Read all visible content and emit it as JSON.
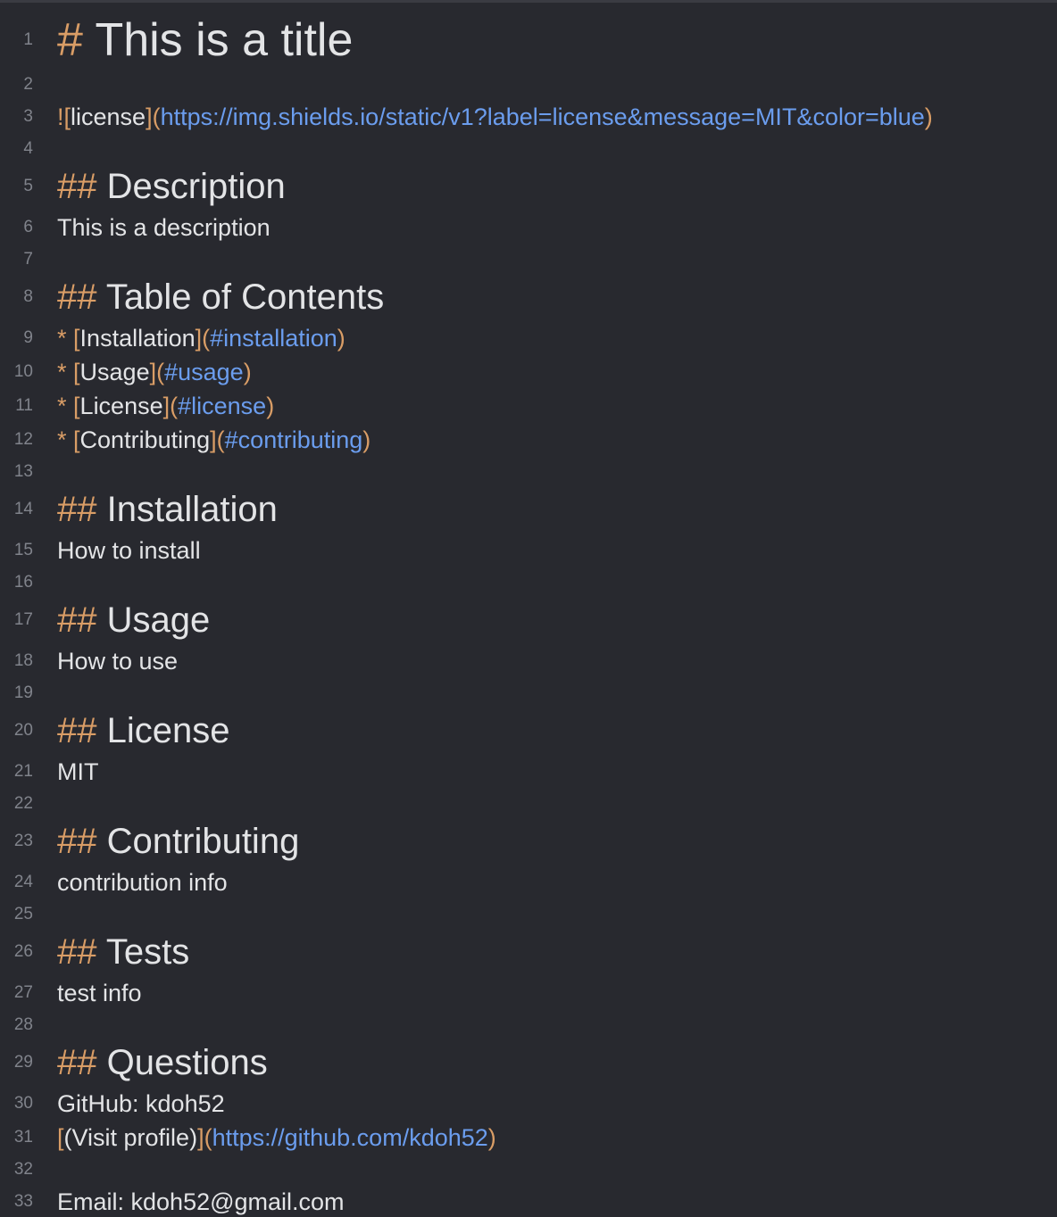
{
  "lines": {
    "l1": {
      "num": "1",
      "marker": "#",
      "text": "This is a title"
    },
    "l2": {
      "num": "2"
    },
    "l3": {
      "num": "3",
      "bang": "!",
      "open": "[",
      "label": "license",
      "close": "]",
      "popen": "(",
      "url": "https://img.shields.io/static/v1?label=license&message=MIT&color=blue",
      "pclose": ")"
    },
    "l4": {
      "num": "4"
    },
    "l5": {
      "num": "5",
      "marker": "##",
      "text": "Description"
    },
    "l6": {
      "num": "6",
      "text": "This is a description"
    },
    "l7": {
      "num": "7"
    },
    "l8": {
      "num": "8",
      "marker": "##",
      "text": "Table of Contents"
    },
    "l9": {
      "num": "9",
      "bullet": "*",
      "open": "[",
      "label": "Installation",
      "close": "]",
      "popen": "(",
      "url": "#installation",
      "pclose": ")"
    },
    "l10": {
      "num": "10",
      "bullet": "*",
      "open": "[",
      "label": "Usage",
      "close": "]",
      "popen": "(",
      "url": "#usage",
      "pclose": ")"
    },
    "l11": {
      "num": "11",
      "bullet": "*",
      "open": "[",
      "label": "License",
      "close": "]",
      "popen": "(",
      "url": "#license",
      "pclose": ")"
    },
    "l12": {
      "num": "12",
      "bullet": "*",
      "open": "[",
      "label": "Contributing",
      "close": "]",
      "popen": "(",
      "url": "#contributing",
      "pclose": ")"
    },
    "l13": {
      "num": "13"
    },
    "l14": {
      "num": "14",
      "marker": "##",
      "text": "Installation"
    },
    "l15": {
      "num": "15",
      "text": "How to install"
    },
    "l16": {
      "num": "16"
    },
    "l17": {
      "num": "17",
      "marker": "##",
      "text": "Usage"
    },
    "l18": {
      "num": "18",
      "text": "How to use"
    },
    "l19": {
      "num": "19"
    },
    "l20": {
      "num": "20",
      "marker": "##",
      "text": "License"
    },
    "l21": {
      "num": "21",
      "text": "MIT"
    },
    "l22": {
      "num": "22"
    },
    "l23": {
      "num": "23",
      "marker": "##",
      "text": "Contributing"
    },
    "l24": {
      "num": "24",
      "text": "contribution info"
    },
    "l25": {
      "num": "25"
    },
    "l26": {
      "num": "26",
      "marker": "##",
      "text": "Tests"
    },
    "l27": {
      "num": "27",
      "text": "test info"
    },
    "l28": {
      "num": "28"
    },
    "l29": {
      "num": "29",
      "marker": "##",
      "text": "Questions"
    },
    "l30": {
      "num": "30",
      "text": "GitHub: kdoh52"
    },
    "l31": {
      "num": "31",
      "open": "[",
      "label": "(Visit profile)",
      "close": "]",
      "popen": "(",
      "url": "https://github.com/kdoh52",
      "pclose": ")"
    },
    "l32": {
      "num": "32"
    },
    "l33": {
      "num": "33",
      "text": "Email: kdoh52@gmail.com"
    }
  },
  "colors": {
    "background": "#28292f",
    "text": "#e3e4e6",
    "line_number": "#80838b",
    "markdown_syntax": "#d99d66",
    "link_url": "#6b9dee"
  }
}
